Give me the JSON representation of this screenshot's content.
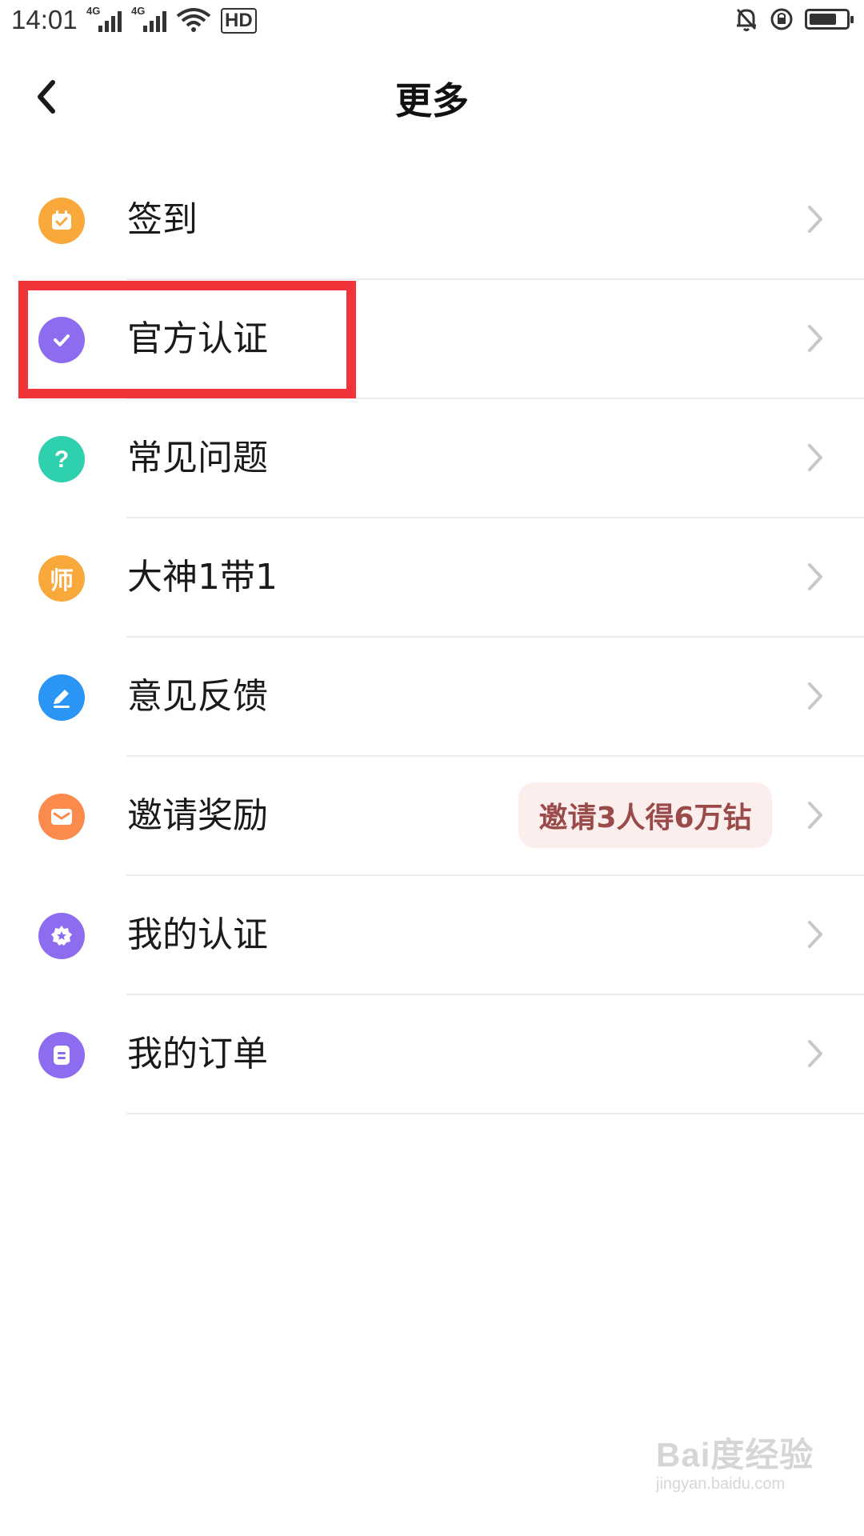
{
  "status_bar": {
    "time": "14:01",
    "network_1": "4G",
    "network_2": "4G",
    "hd_label": "HD",
    "battery_level": 0.75
  },
  "header": {
    "title": "更多",
    "back_icon": "chevron-left-icon"
  },
  "colors": {
    "highlight_border": "#f0343a",
    "badge_bg": "#fdeeee",
    "badge_text": "#9b4a4a"
  },
  "menu": {
    "items": [
      {
        "label": "签到",
        "icon": "calendar-check-icon",
        "color": "#f9a83c"
      },
      {
        "label": "官方认证",
        "icon": "check-circle-icon",
        "color": "#8e6cf0"
      },
      {
        "label": "常见问题",
        "icon": "question-icon",
        "color": "#2fd0ae"
      },
      {
        "label": "大神1带1",
        "icon": "mentor-icon",
        "icon_text": "师",
        "color": "#f9a83c"
      },
      {
        "label": "意见反馈",
        "icon": "pencil-icon",
        "color": "#2a95f4"
      },
      {
        "label": "邀请奖励",
        "icon": "envelope-icon",
        "color": "#fb8a4d",
        "badge": "邀请3人得6万钻"
      },
      {
        "label": "我的认证",
        "icon": "badge-star-icon",
        "color": "#8e6cf0"
      },
      {
        "label": "我的订单",
        "icon": "order-icon",
        "color": "#8e6cf0"
      }
    ]
  },
  "watermark": {
    "main": "Bai度经验",
    "sub": "jingyan.baidu.com"
  }
}
